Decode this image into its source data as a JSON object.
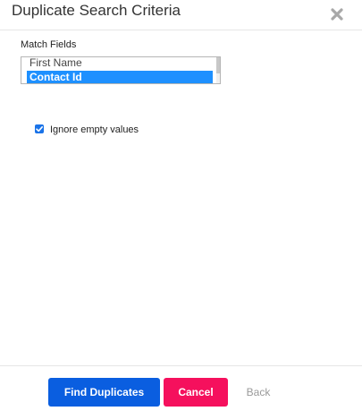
{
  "dialog": {
    "title": "Duplicate Search Criteria",
    "close_icon": "close-x-icon"
  },
  "match_fields": {
    "label": "Match Fields",
    "options": [
      "First Name",
      "Contact Id"
    ],
    "selected": "Contact Id"
  },
  "ignore_empty": {
    "label": "Ignore empty values",
    "checked": true
  },
  "footer": {
    "find_label": "Find Duplicates",
    "cancel_label": "Cancel",
    "back_label": "Back"
  },
  "colors": {
    "primary": "#0a5ee0",
    "danger": "#f5105d",
    "selection": "#1e90ff",
    "checkbox": "#1a73e8"
  }
}
